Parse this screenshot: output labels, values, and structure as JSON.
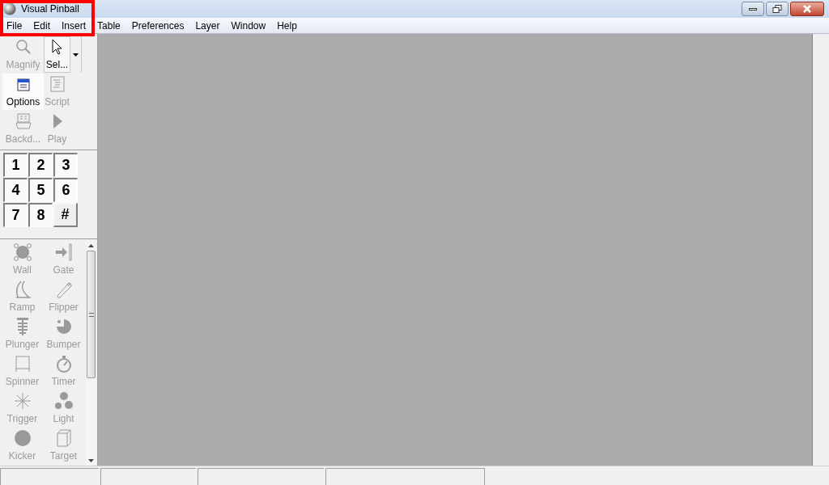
{
  "window": {
    "title": "Visual Pinball"
  },
  "menu": [
    "File",
    "Edit",
    "Insert",
    "Table",
    "Preferences",
    "Layer",
    "Window",
    "Help"
  ],
  "tools": [
    {
      "label": "Magnify",
      "kind": "magnify",
      "disabled": true,
      "selected": false
    },
    {
      "label": "Sel...",
      "kind": "select",
      "disabled": false,
      "selected": true
    },
    {
      "label": "Options",
      "kind": "options",
      "disabled": false,
      "selected": false
    },
    {
      "label": "Script",
      "kind": "script",
      "disabled": true,
      "selected": false
    },
    {
      "label": "Backd...",
      "kind": "backdrop",
      "disabled": true,
      "selected": false
    },
    {
      "label": "Play",
      "kind": "play",
      "disabled": true,
      "selected": false
    }
  ],
  "layers": [
    {
      "label": "1",
      "pressed": true
    },
    {
      "label": "2",
      "pressed": true
    },
    {
      "label": "3",
      "pressed": true
    },
    {
      "label": "4",
      "pressed": true
    },
    {
      "label": "5",
      "pressed": true
    },
    {
      "label": "6",
      "pressed": true
    },
    {
      "label": "7",
      "pressed": true
    },
    {
      "label": "8",
      "pressed": true
    },
    {
      "label": "#",
      "pressed": false
    }
  ],
  "elements": [
    {
      "label": "Wall",
      "kind": "wall",
      "disabled": true
    },
    {
      "label": "Gate",
      "kind": "gate",
      "disabled": true
    },
    {
      "label": "Ramp",
      "kind": "ramp",
      "disabled": true
    },
    {
      "label": "Flipper",
      "kind": "flipper",
      "disabled": true
    },
    {
      "label": "Plunger",
      "kind": "plunger",
      "disabled": true
    },
    {
      "label": "Bumper",
      "kind": "bumper",
      "disabled": true
    },
    {
      "label": "Spinner",
      "kind": "spinner",
      "disabled": true
    },
    {
      "label": "Timer",
      "kind": "timer",
      "disabled": true
    },
    {
      "label": "Trigger",
      "kind": "trigger",
      "disabled": true
    },
    {
      "label": "Light",
      "kind": "light",
      "disabled": true
    },
    {
      "label": "Kicker",
      "kind": "kicker",
      "disabled": true
    },
    {
      "label": "Target",
      "kind": "target",
      "disabled": true
    }
  ]
}
